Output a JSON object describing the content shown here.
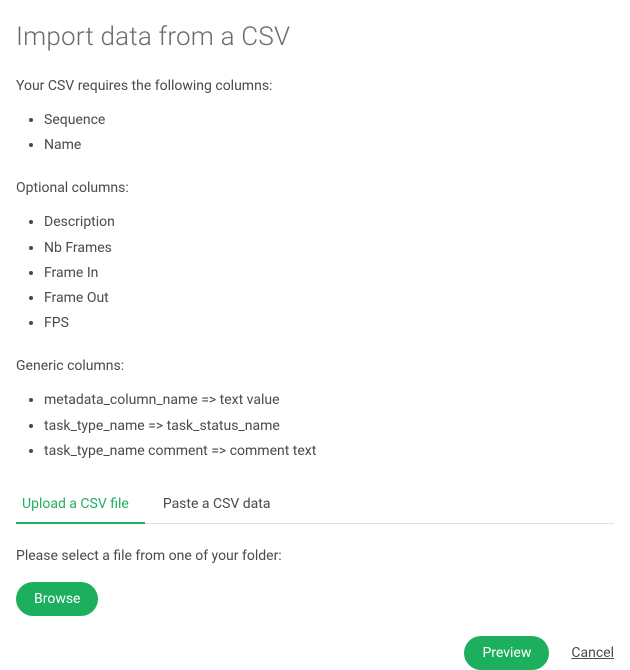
{
  "title": "Import data from a CSV",
  "required": {
    "label": "Your CSV requires the following columns:",
    "items": [
      "Sequence",
      "Name"
    ]
  },
  "optional": {
    "label": "Optional columns:",
    "items": [
      "Description",
      "Nb Frames",
      "Frame In",
      "Frame Out",
      "FPS"
    ]
  },
  "generic": {
    "label": "Generic columns:",
    "items": [
      "metadata_column_name => text value",
      "task_type_name => task_status_name",
      "task_type_name comment => comment text"
    ]
  },
  "tabs": {
    "upload": "Upload a CSV file",
    "paste": "Paste a CSV data"
  },
  "upload": {
    "instruction": "Please select a file from one of your folder:",
    "browse": "Browse"
  },
  "actions": {
    "preview": "Preview",
    "cancel": "Cancel"
  }
}
